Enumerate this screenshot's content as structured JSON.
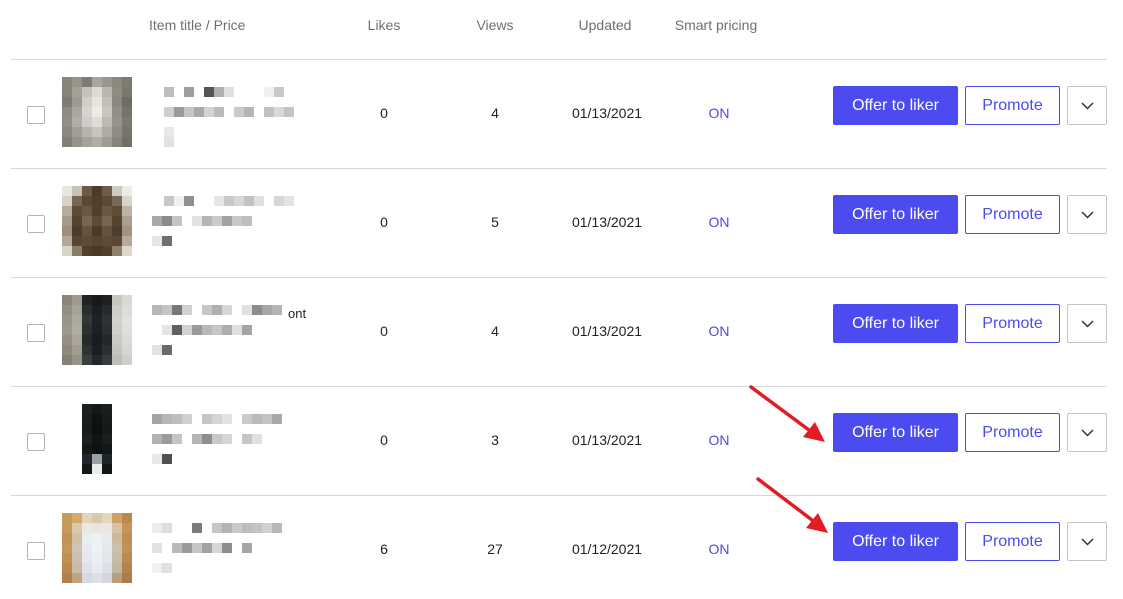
{
  "header": {
    "item_title_price": "Item title / Price",
    "likes": "Likes",
    "views": "Views",
    "updated": "Updated",
    "smart_pricing": "Smart pricing"
  },
  "colors": {
    "accent": "#4b4bf0",
    "on_status": "#4a4ae6",
    "annotation_arrow": "#e31b23"
  },
  "icons": {
    "more_button": "chevron-down-icon",
    "annotation": "red-arrow-icon"
  },
  "rows": [
    {
      "title_fragment": "",
      "likes": "0",
      "views": "4",
      "updated": "01/13/2021",
      "smart_pricing": "ON",
      "offer_label": "Offer to liker",
      "promote_label": "Promote"
    },
    {
      "title_fragment": "",
      "likes": "0",
      "views": "5",
      "updated": "01/13/2021",
      "smart_pricing": "ON",
      "offer_label": "Offer to liker",
      "promote_label": "Promote"
    },
    {
      "title_fragment": "ont",
      "likes": "0",
      "views": "4",
      "updated": "01/13/2021",
      "smart_pricing": "ON",
      "offer_label": "Offer to liker",
      "promote_label": "Promote"
    },
    {
      "title_fragment": "",
      "likes": "0",
      "views": "3",
      "updated": "01/13/2021",
      "smart_pricing": "ON",
      "offer_label": "Offer to liker",
      "promote_label": "Promote"
    },
    {
      "title_fragment": "",
      "likes": "6",
      "views": "27",
      "updated": "01/12/2021",
      "smart_pricing": "ON",
      "offer_label": "Offer to liker",
      "promote_label": "Promote"
    }
  ]
}
